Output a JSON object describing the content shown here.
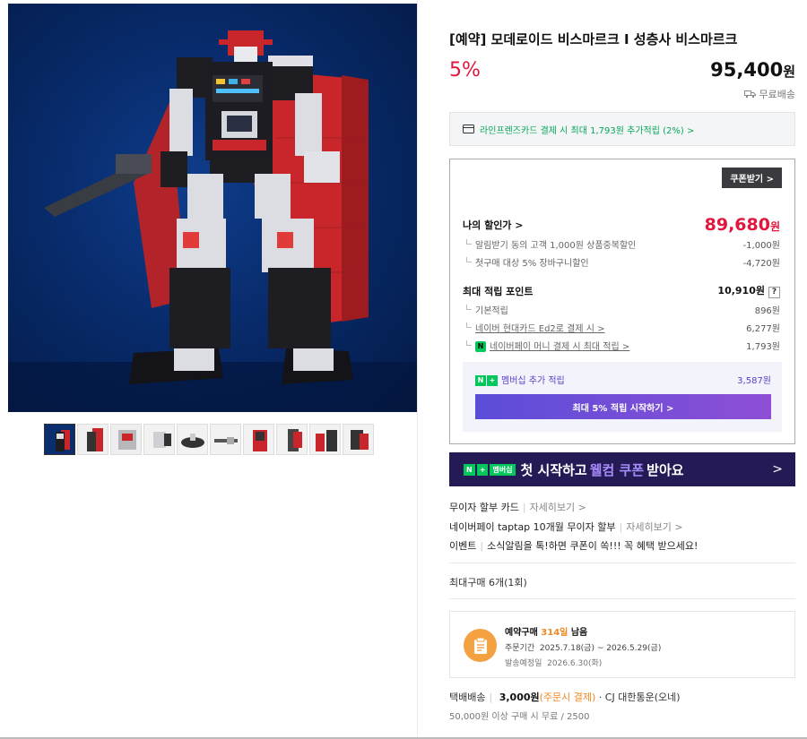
{
  "product": {
    "title": "[예약] 모데로이드 비스마르크 I 성층사 비스마르크",
    "discount_rate": "5%",
    "price": "95,400",
    "price_unit": "원",
    "shipping_label": "무료배송"
  },
  "gallery": {
    "thumbnail_count": 10,
    "selected_index": 0
  },
  "card_promo": {
    "text": "라인프렌즈카드 결제 시 최대 1,793원 추가적립 (2%) >"
  },
  "benefits": {
    "coupon_button": "쿠폰받기 >",
    "my_price_label": "나의 할인가 >",
    "my_price_value": "89,680",
    "my_price_unit": "원",
    "discounts": [
      {
        "label": "알림받기 동의 고객 1,000원 상품중복할인",
        "value": "-1,000원"
      },
      {
        "label": "첫구매 대상 5% 장바구니할인",
        "value": "-4,720원"
      }
    ],
    "points_label": "최대 적립 포인트",
    "points_value": "10,910원",
    "points_help": "?",
    "points": [
      {
        "label": "기본적립",
        "value": "896원"
      },
      {
        "label": "네이버 현대카드 Ed2로 결제 시 >",
        "value": "6,277원"
      },
      {
        "label": "네이버페이 머니 결제 시 최대 적립 >",
        "value": "1,793원"
      }
    ],
    "npay_badge": "N",
    "membership_label": "멤버십 추가 적립",
    "membership_value": "3,587원",
    "membership_button": "최대 5% 적립 시작하기 >"
  },
  "banner": {
    "badge_n": "N",
    "badge_plus": "+",
    "badge_membership": "멤버십",
    "text_1": "첫 시작하고",
    "text_2": "웰컴 쿠폰",
    "text_3": "받아요",
    "chevron": ">"
  },
  "info": [
    {
      "label": "무이자 할부 카드",
      "link": "자세히보기 >"
    },
    {
      "label": "네이버페이 taptap 10개월 무이자 할부",
      "link": "자세히보기 >"
    },
    {
      "label": "이벤트",
      "link": "소식알림을 톡!하면 쿠폰이 쏙!!! 꼭 혜택 받으세요!"
    }
  ],
  "max_purchase": "최대구매 6개(1회)",
  "preorder": {
    "title_prefix": "예약구매",
    "days_left": "314일",
    "title_suffix": "남음",
    "order_period_label": "주문기간",
    "order_period": "2025.7.18(금) ~ 2026.5.29(금)",
    "ship_date_label": "발송예정일",
    "ship_date": "2026.6.30(화)"
  },
  "delivery": {
    "label": "택배배송",
    "fee": "3,000원",
    "fee_note": "(주문시 결제)",
    "carrier": "· CJ 대한통운(오네)",
    "free_condition": "50,000원 이상 구매 시 무료 / 2500"
  },
  "colors": {
    "discount_red": "#e3163e",
    "naver_green": "#03c75a",
    "membership_purple": "#5a42c9",
    "banner_bg": "#241a55",
    "preorder_orange": "#f4a241"
  }
}
